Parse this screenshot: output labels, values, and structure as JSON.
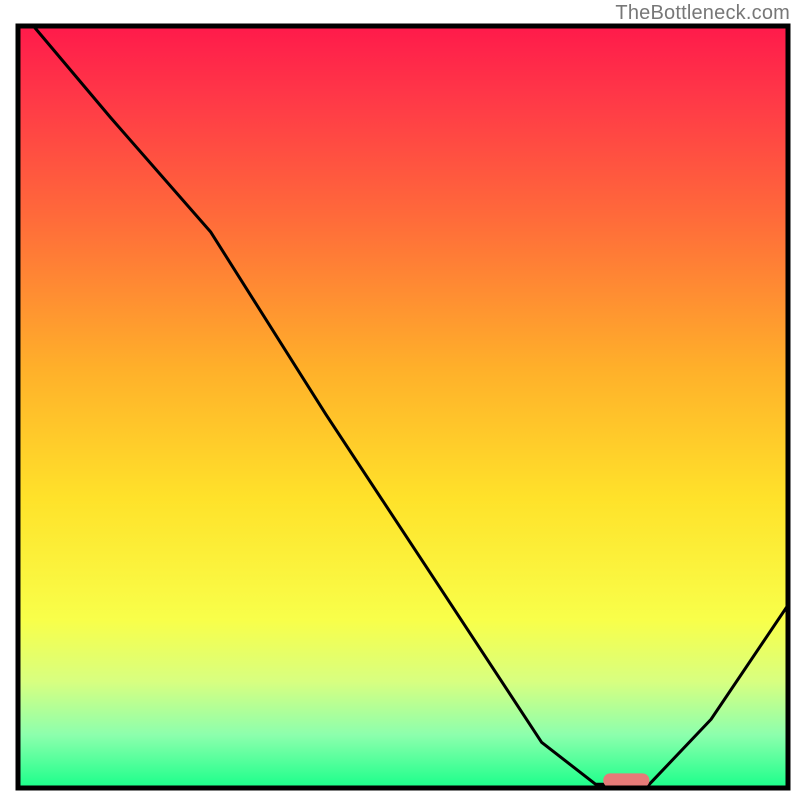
{
  "watermark": "TheBottleneck.com",
  "chart_data": {
    "type": "line",
    "title": "",
    "xlabel": "",
    "ylabel": "",
    "xlim": [
      0,
      100
    ],
    "ylim": [
      0,
      100
    ],
    "notes": "Qualitative bottleneck curve: y-axis is implied bottleneck-percentage (bad=top=red, good=bottom=green). Background is a vertical rainbow gradient from red (top) → orange → yellow → green (bottom). Curve starts at top-left (~100%), descends with a slight knee near x≈25, reaches ~0% around x≈75–82 (plateau), then rises again toward right edge. A short pink marker segment sits on the plateau at roughly x 76–82.",
    "curve_points": [
      {
        "x": 2,
        "y": 100
      },
      {
        "x": 12,
        "y": 88
      },
      {
        "x": 25,
        "y": 73
      },
      {
        "x": 40,
        "y": 49
      },
      {
        "x": 55,
        "y": 26
      },
      {
        "x": 68,
        "y": 6
      },
      {
        "x": 75,
        "y": 0.5
      },
      {
        "x": 82,
        "y": 0.5
      },
      {
        "x": 90,
        "y": 9
      },
      {
        "x": 100,
        "y": 24
      }
    ],
    "marker": {
      "x_start": 76,
      "x_end": 82,
      "y": 1,
      "color": "#e77b78"
    },
    "gradient_stops": [
      {
        "offset": 0.0,
        "color": "#ff1a4b"
      },
      {
        "offset": 0.1,
        "color": "#ff3a47"
      },
      {
        "offset": 0.25,
        "color": "#ff6a3a"
      },
      {
        "offset": 0.45,
        "color": "#ffb02a"
      },
      {
        "offset": 0.62,
        "color": "#ffe22a"
      },
      {
        "offset": 0.78,
        "color": "#f8ff4a"
      },
      {
        "offset": 0.86,
        "color": "#d8ff80"
      },
      {
        "offset": 0.93,
        "color": "#8dffad"
      },
      {
        "offset": 1.0,
        "color": "#1aff8a"
      }
    ],
    "frame_color": "#000000",
    "line_color": "#000000"
  }
}
